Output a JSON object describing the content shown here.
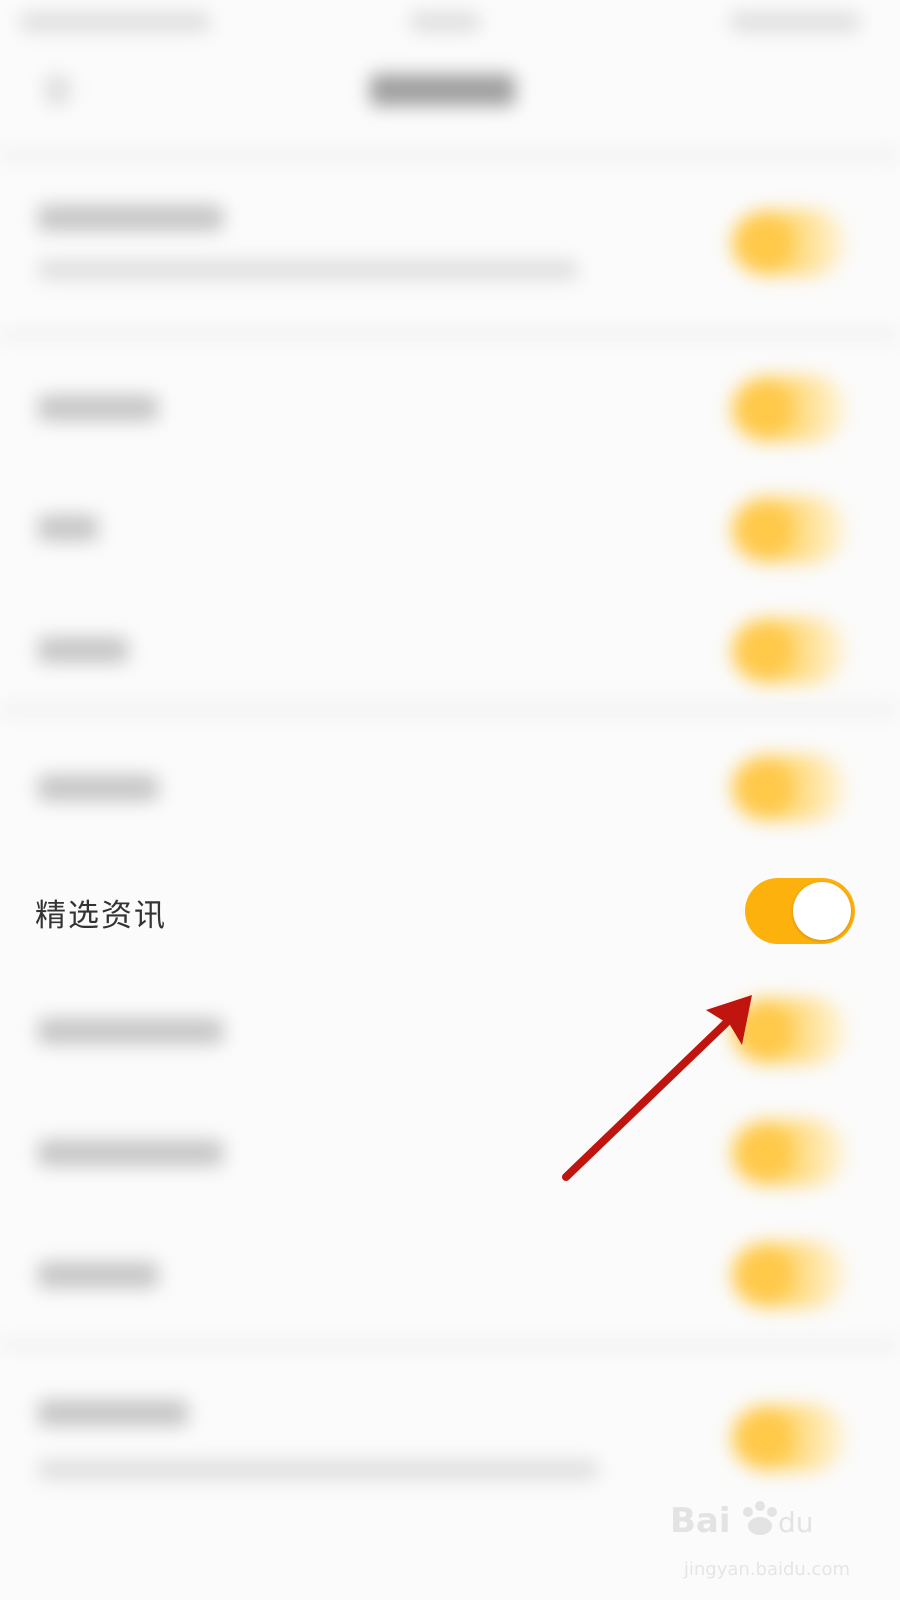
{
  "settings": {
    "highlighted_row": {
      "label": "精选资讯",
      "toggle_state": "on"
    }
  },
  "colors": {
    "toggle_on": "#fdb10d",
    "toggle_knob": "#ffffff",
    "annotation_arrow": "#c0140f",
    "background": "#fbfbfb"
  },
  "watermark": {
    "logo": "Baidu经验",
    "url": "jingyan.baidu.com"
  }
}
